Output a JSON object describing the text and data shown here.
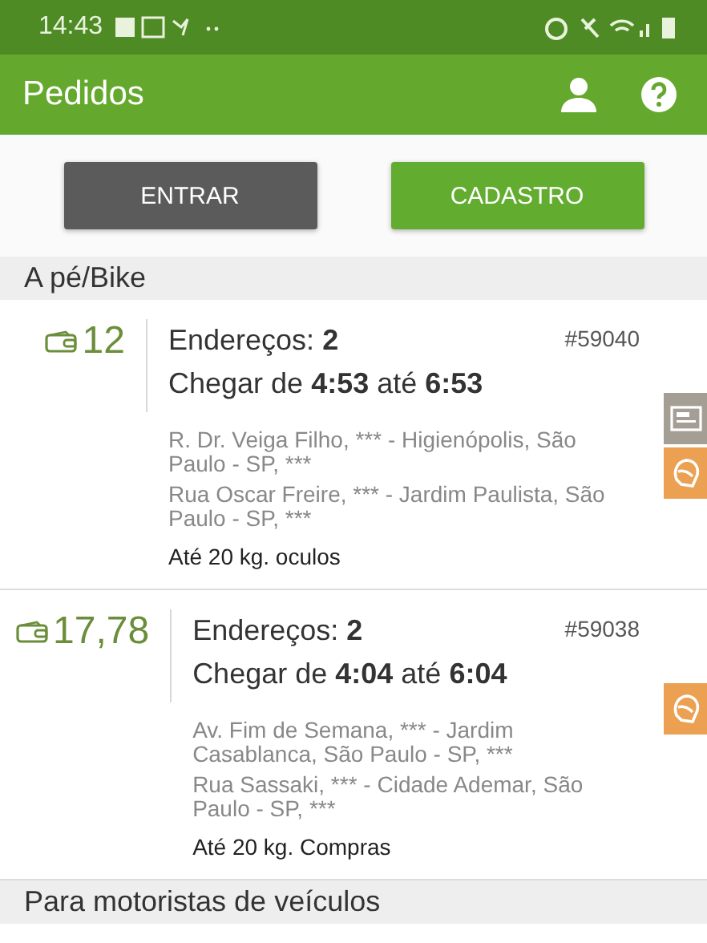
{
  "status_bar": {
    "time": "14:43"
  },
  "app_bar": {
    "title": "Pedidos"
  },
  "buttons": [
    {
      "label": "ENTRAR",
      "kind": "secondary"
    },
    {
      "label": "CADASTRO",
      "kind": "primary"
    }
  ],
  "sections": [
    {
      "title": "A pé/Bike",
      "orders": [
        {
          "price": "12",
          "number": "#59040",
          "addresses_line": "Endereços: **2**",
          "arrival": "Chegar de **4:53** até **6:53**",
          "addresses": [
            "R. Dr. Veiga Filho, *** - Higienópolis, São Paulo - SP, ***",
            "Rua Oscar Freire, *** - Jardim Paulista, São Paulo - SP, ***"
          ],
          "note": "Até 20 kg. oculos",
          "badges": [
            {
              "kind": "id-card"
            },
            {
              "kind": "helmet"
            }
          ]
        },
        {
          "price": "17,78",
          "number": "#59038",
          "addresses_line": "Endereços: **2**",
          "arrival": "Chegar de **4:04** até **6:04**",
          "addresses": [
            "Av. Fim de Semana, *** - Jardim Casablanca, São Paulo - SP, ***",
            "Rua Sassaki, *** - Cidade Ademar, São Paulo - SP, ***"
          ],
          "note": "Até 20 kg. Compras",
          "badges": [
            {
              "kind": "helmet"
            }
          ]
        }
      ]
    },
    {
      "title": "Para motoristas de veículos"
    }
  ]
}
